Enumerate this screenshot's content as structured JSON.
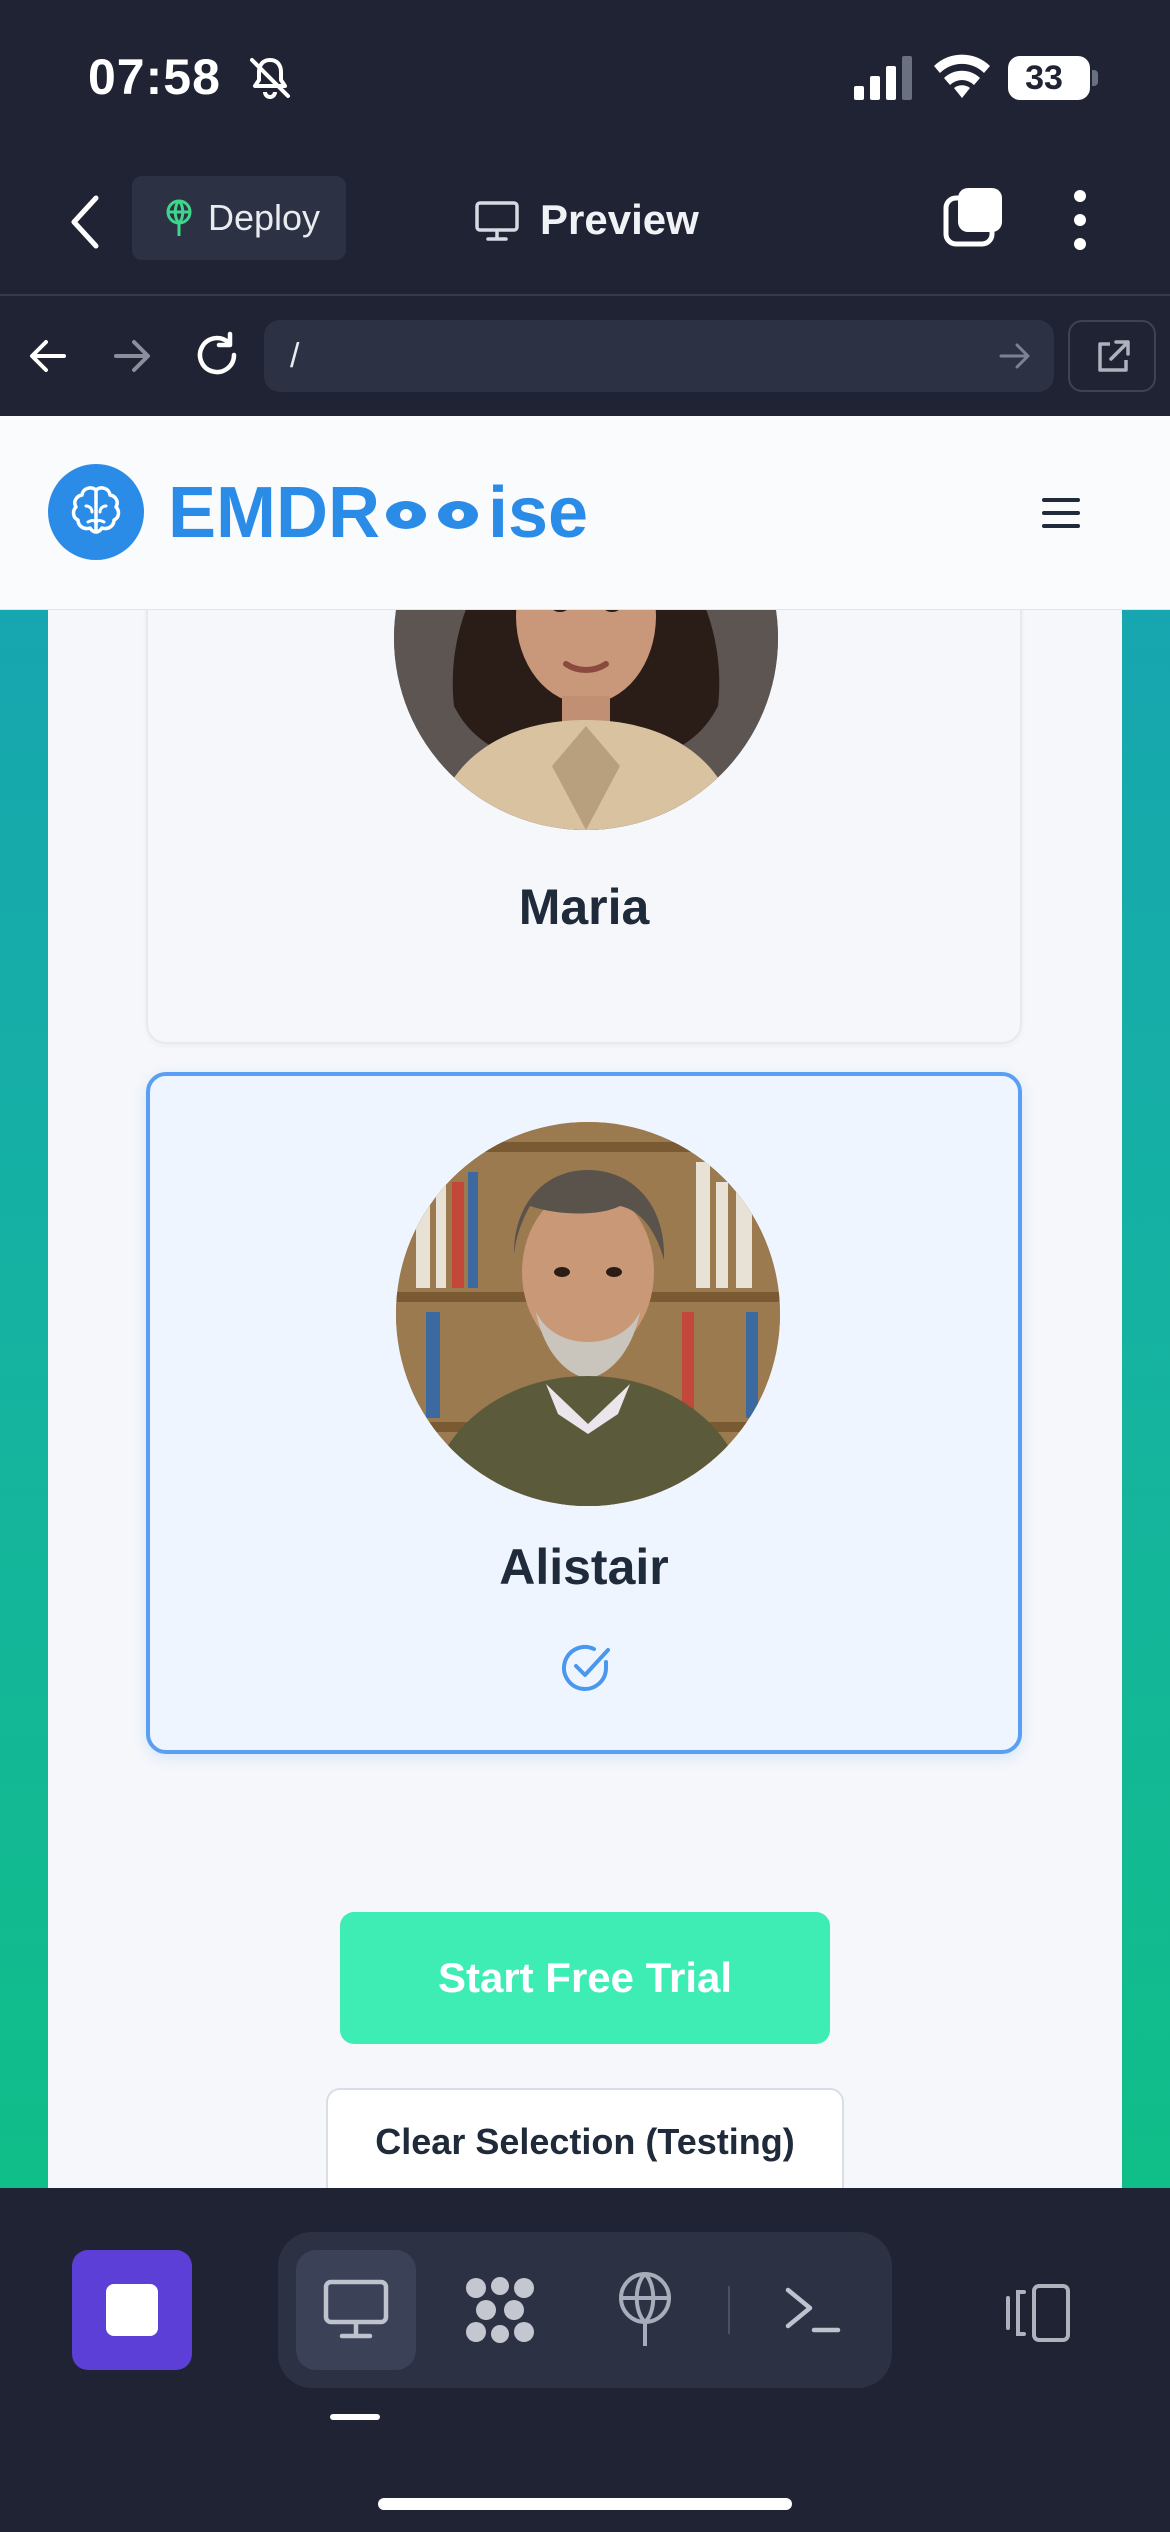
{
  "status_bar": {
    "time": "07:58",
    "battery": "33",
    "icons": [
      "bell-slash-icon",
      "cellular-signal-icon",
      "wifi-icon",
      "battery-icon"
    ]
  },
  "app_bar": {
    "deploy_label": "Deploy",
    "preview_label": "Preview",
    "icons": [
      "back-chevron-icon",
      "deploy-icon",
      "monitor-icon",
      "tabs-icon",
      "kebab-menu-icon"
    ]
  },
  "browser": {
    "url": "/",
    "icons": [
      "arrow-left-icon",
      "arrow-right-icon",
      "reload-icon",
      "go-arrow-icon",
      "open-external-icon"
    ]
  },
  "site": {
    "logo_text_left": "EMDR",
    "logo_text_right": "ise",
    "brand_color": "#2b8ce8",
    "icons": [
      "brain-icon",
      "hamburger-menu-icon"
    ]
  },
  "therapists": [
    {
      "name": "Maria",
      "selected": false
    },
    {
      "name": "Alistair",
      "selected": true
    }
  ],
  "actions": {
    "start_trial": "Start Free Trial",
    "clear_selection": "Clear Selection (Testing)",
    "trial_color": "#3dedb4"
  },
  "bottom_bar": {
    "icons": [
      "stop-icon",
      "monitor-icon",
      "grid-icon",
      "deploy-icon",
      "terminal-icon",
      "layout-icon"
    ],
    "active_tool": "monitor-icon",
    "stop_color": "#5b3fd6"
  }
}
